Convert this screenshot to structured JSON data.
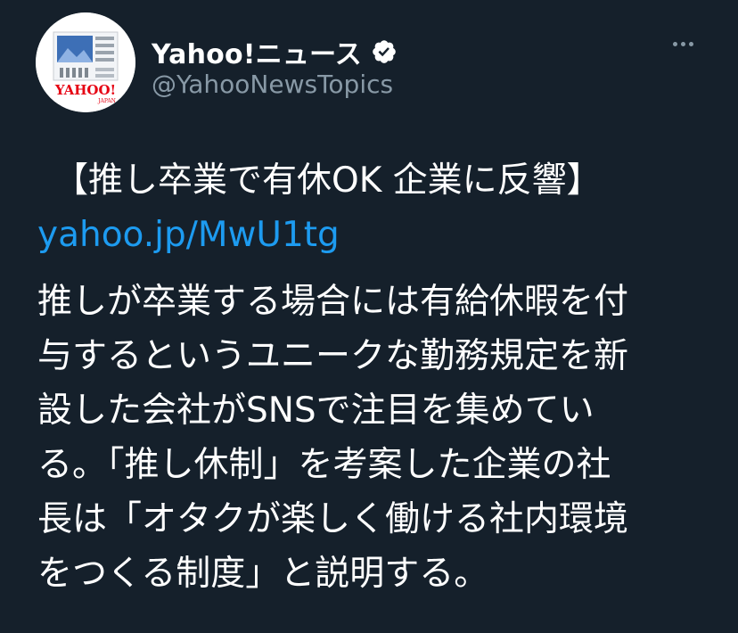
{
  "account": {
    "display_name": "Yahoo!ニュース",
    "handle": "@YahooNewsTopics",
    "avatar_logo_text": "YAHOO!",
    "avatar_logo_subtext": "JAPAN",
    "verified_icon": "verified-badge-icon",
    "more_icon": "more-horizontal-icon"
  },
  "tweet": {
    "headline": "【推し卒業で有休OK 企業に反響】",
    "link": "yahoo.jp/MwU1tg",
    "body_lines": [
      "推しが卒業する場合には有給休暇を付",
      "与するというユニークな勤務規定を新",
      "設した会社がSNSで注目を集めてい",
      "る。「推し休制」を考案した企業の社",
      "長は「オタクが楽しく働ける社内環境",
      "をつくる制度」と説明する。"
    ]
  },
  "colors": {
    "background": "#15202b",
    "text_primary": "#ffffff",
    "text_secondary": "#8899a6",
    "link": "#1d9bf0",
    "logo_red": "#e60012"
  }
}
